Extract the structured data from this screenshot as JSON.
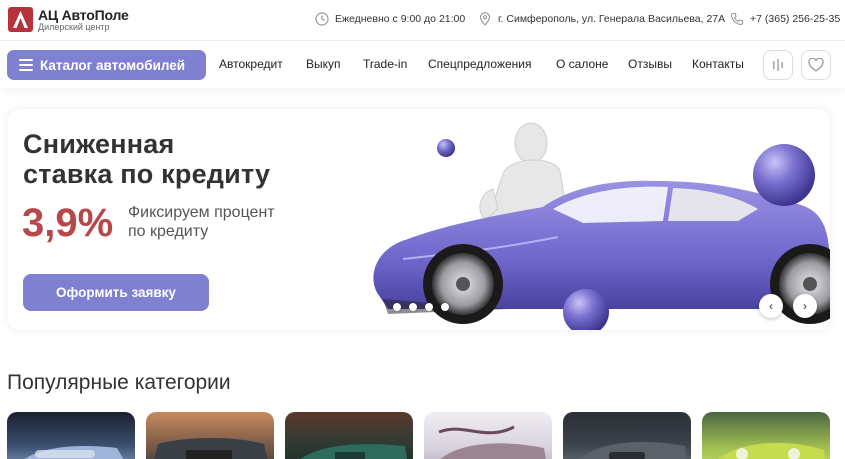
{
  "brand": {
    "name": "АЦ АвтоПоле",
    "subtitle": "Дилерский центр",
    "color": "#b8323c"
  },
  "contacts": {
    "hours": "Ежедневно с 9:00 до 21:00",
    "address": "г. Симферополь, ул. Генерала Васильева, 27А",
    "phone": "+7 (365) 256-25-35"
  },
  "nav": {
    "catalog": "Каталог автомобилей",
    "links": [
      "Автокредит",
      "Выкуп",
      "Trade-in",
      "Спецпредложения",
      "О салоне",
      "Отзывы",
      "Контакты"
    ],
    "icons": [
      "compare-icon",
      "heart-icon"
    ]
  },
  "banner": {
    "title": "Сниженная\nставка по кредиту",
    "rate": "3,9%",
    "description": "Фиксируем процент\nпо кредиту",
    "button": "Оформить заявку",
    "slides": 4,
    "active_slide": 1
  },
  "popular": {
    "title": "Популярные категории",
    "cards": [
      "card-1",
      "card-2",
      "card-3",
      "card-4",
      "card-5",
      "card-6"
    ]
  },
  "colors": {
    "accent": "#8080d0",
    "rate": "#b8474a",
    "car": "#7b72d1"
  }
}
